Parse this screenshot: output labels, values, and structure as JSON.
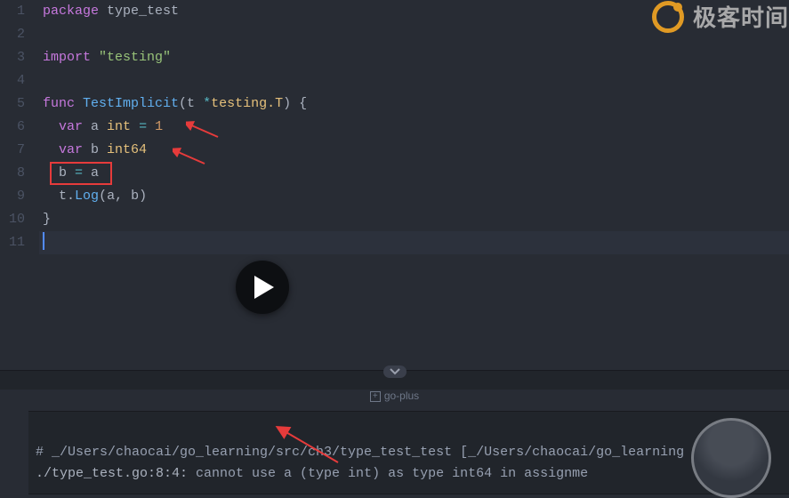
{
  "watermark": {
    "text": "极客时间"
  },
  "gutter": [
    "1",
    "2",
    "3",
    "4",
    "5",
    "6",
    "7",
    "8",
    "9",
    "10",
    "11"
  ],
  "code": {
    "l1": {
      "kw": "package",
      "pkg": " type_test"
    },
    "l3": {
      "kw": "import",
      "str": " \"testing\""
    },
    "l5": {
      "kw": "func",
      "fn": " TestImplicit",
      "args_open": "(t ",
      "op1": "*",
      "type": "testing.T",
      "args_close": ") {"
    },
    "l6": {
      "indent": "  ",
      "kw": "var",
      "name": " a ",
      "type": "int",
      "eq": " = ",
      "num": "1"
    },
    "l7": {
      "indent": "  ",
      "kw": "var",
      "name": " b ",
      "type": "int64"
    },
    "l8": {
      "indent": "  ",
      "lhs": "b ",
      "eq": "=",
      "rhs": " a"
    },
    "l9": {
      "indent": "  ",
      "obj": "t",
      "dot": ".",
      "method": "Log",
      "args": "(a, b)"
    },
    "l10": {
      "brace": "}"
    }
  },
  "panel": {
    "label": "go-plus"
  },
  "terminal": {
    "line1": "# _/Users/chaocai/go_learning/src/ch3/type_test_test [_/Users/chaocai/go_learning",
    "line2_loc": "./type_test.go:8:4:",
    "line2_msg": " cannot use a (type int) as type int64 in assignme"
  }
}
